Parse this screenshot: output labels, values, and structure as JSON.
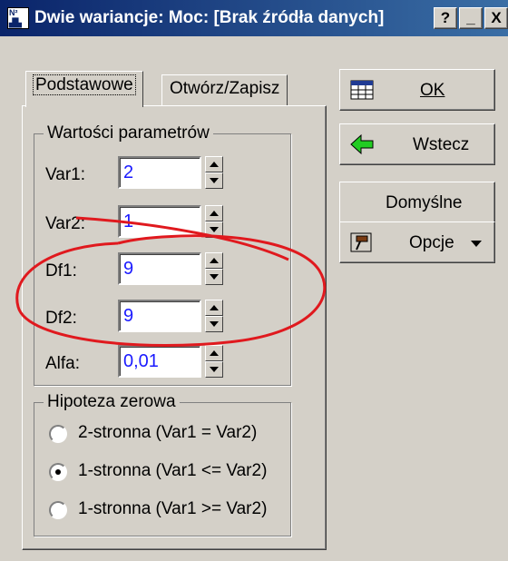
{
  "titlebar": {
    "title": "Dwie wariancje: Moc: [Brak źródła danych]",
    "icon": "chart-app-icon",
    "help_label": "?",
    "minimize_label": "_",
    "close_label": "X"
  },
  "tabs": [
    {
      "label": "Podstawowe",
      "active": true
    },
    {
      "label": "Otwórz/Zapisz",
      "active": false
    }
  ],
  "params_group": {
    "title": "Wartości parametrów",
    "fields": [
      {
        "label": "Var1:",
        "value": "2"
      },
      {
        "label": "Var2:",
        "value": "1"
      },
      {
        "label": "Df1:",
        "value": "9"
      },
      {
        "label": "Df2:",
        "value": "9"
      },
      {
        "label": "Alfa:",
        "value": "0,01"
      }
    ]
  },
  "hypothesis_group": {
    "title": "Hipoteza zerowa",
    "options": [
      {
        "label": "2-stronna (Var1 = Var2)",
        "checked": false
      },
      {
        "label": "1-stronna (Var1 <= Var2)",
        "checked": true
      },
      {
        "label": "1-stronna (Var1 >= Var2)",
        "checked": false
      }
    ]
  },
  "buttons": {
    "ok": {
      "label": "OK",
      "icon": "table-icon"
    },
    "back": {
      "label": "Wstecz",
      "icon": "green-arrow-left-icon"
    },
    "defaults": {
      "label": "Domyślne"
    },
    "options": {
      "label": "Opcje",
      "icon": "hammer-icon"
    }
  },
  "annotation": {
    "color": "#e0191e",
    "shape": "ellipse-and-slash"
  }
}
